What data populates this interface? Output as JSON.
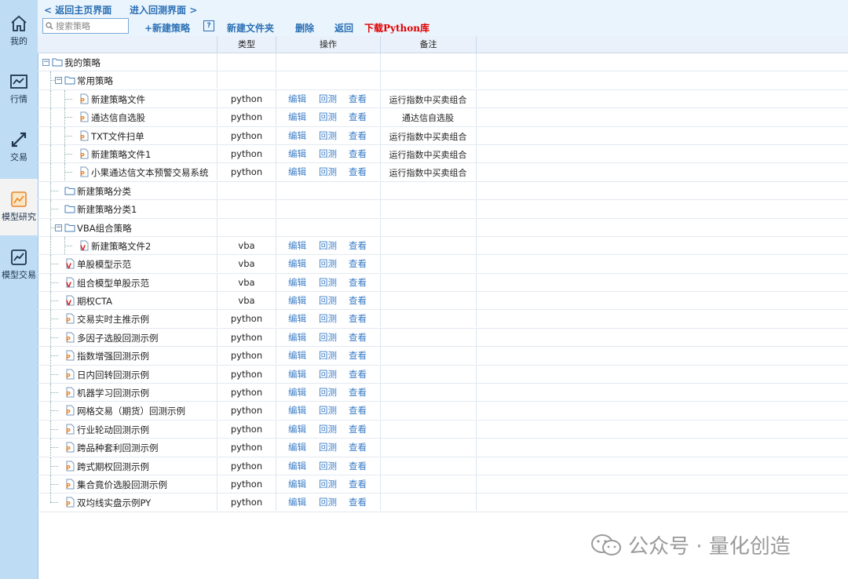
{
  "sidebar": {
    "items": [
      {
        "label": "我的",
        "icon": "home-icon"
      },
      {
        "label": "行情",
        "icon": "chart-line-icon"
      },
      {
        "label": "交易",
        "icon": "exchange-arrows-icon"
      },
      {
        "label": "模型研究",
        "icon": "model-research-icon",
        "active": true
      },
      {
        "label": "模型交易",
        "icon": "model-trade-icon"
      }
    ]
  },
  "breadcrumb": {
    "back_home": "返回主页界面",
    "enter_backtest": "进入回测界面"
  },
  "toolbar": {
    "search_placeholder": "搜索策略",
    "new_strategy": "+新建策略",
    "help": "?",
    "new_folder": "新建文件夹",
    "delete": "删除",
    "back": "返回",
    "download_lib": "下载Python库"
  },
  "table": {
    "headers": {
      "type": "类型",
      "ops": "操作",
      "note": "备注"
    },
    "op_labels": {
      "edit": "编辑",
      "backtest": "回测",
      "view": "查看"
    },
    "rows": [
      {
        "level": 0,
        "kind": "folder",
        "expand": "⊟",
        "name": "我的策略",
        "type": "",
        "ops": false,
        "note": ""
      },
      {
        "level": 1,
        "kind": "folder",
        "expand": "⊟",
        "name": "常用策略",
        "type": "",
        "ops": false,
        "note": ""
      },
      {
        "level": 2,
        "kind": "py",
        "name": "新建策略文件",
        "type": "python",
        "ops": true,
        "note": "运行指数中买卖组合"
      },
      {
        "level": 2,
        "kind": "py",
        "name": "通达信自选股",
        "type": "python",
        "ops": true,
        "note": "通达信自选股"
      },
      {
        "level": 2,
        "kind": "py",
        "name": "TXT文件扫单",
        "type": "python",
        "ops": true,
        "note": "运行指数中买卖组合"
      },
      {
        "level": 2,
        "kind": "py",
        "name": "新建策略文件1",
        "type": "python",
        "ops": true,
        "note": "运行指数中买卖组合"
      },
      {
        "level": 2,
        "kind": "py",
        "name": "小果通达信文本预警交易系统",
        "type": "python",
        "ops": true,
        "note": "运行指数中买卖组合"
      },
      {
        "level": 1,
        "kind": "folder",
        "name": "新建策略分类",
        "type": "",
        "ops": false,
        "note": ""
      },
      {
        "level": 1,
        "kind": "folder",
        "name": "新建策略分类1",
        "type": "",
        "ops": false,
        "note": ""
      },
      {
        "level": 1,
        "kind": "folder",
        "expand": "⊟",
        "name": "VBA组合策略",
        "type": "",
        "ops": false,
        "note": ""
      },
      {
        "level": 2,
        "kind": "vba",
        "name": "新建策略文件2",
        "type": "vba",
        "ops": true,
        "note": ""
      },
      {
        "level": 1,
        "kind": "vba",
        "name": "单股模型示范",
        "type": "vba",
        "ops": true,
        "note": ""
      },
      {
        "level": 1,
        "kind": "vba",
        "name": "组合模型单股示范",
        "type": "vba",
        "ops": true,
        "note": ""
      },
      {
        "level": 1,
        "kind": "vba",
        "name": "期权CTA",
        "type": "vba",
        "ops": true,
        "note": ""
      },
      {
        "level": 1,
        "kind": "py",
        "name": "交易实时主推示例",
        "type": "python",
        "ops": true,
        "note": ""
      },
      {
        "level": 1,
        "kind": "py",
        "name": "多因子选股回测示例",
        "type": "python",
        "ops": true,
        "note": ""
      },
      {
        "level": 1,
        "kind": "py",
        "name": "指数增强回测示例",
        "type": "python",
        "ops": true,
        "note": ""
      },
      {
        "level": 1,
        "kind": "py",
        "name": "日内回转回测示例",
        "type": "python",
        "ops": true,
        "note": ""
      },
      {
        "level": 1,
        "kind": "py",
        "name": "机器学习回测示例",
        "type": "python",
        "ops": true,
        "note": ""
      },
      {
        "level": 1,
        "kind": "py",
        "name": "网格交易（期货）回测示例",
        "type": "python",
        "ops": true,
        "note": ""
      },
      {
        "level": 1,
        "kind": "py",
        "name": "行业轮动回测示例",
        "type": "python",
        "ops": true,
        "note": ""
      },
      {
        "level": 1,
        "kind": "py",
        "name": "跨品种套利回测示例",
        "type": "python",
        "ops": true,
        "note": ""
      },
      {
        "level": 1,
        "kind": "py",
        "name": "跨式期权回测示例",
        "type": "python",
        "ops": true,
        "note": ""
      },
      {
        "level": 1,
        "kind": "py",
        "name": "集合竟价选股回测示例",
        "type": "python",
        "ops": true,
        "note": ""
      },
      {
        "level": 1,
        "kind": "py",
        "name": "双均线实盘示例PY",
        "type": "python",
        "ops": true,
        "note": ""
      }
    ]
  },
  "watermark": "公众号 · 量化创造",
  "colors": {
    "sidebar_bg": "#bfdcf5",
    "link_blue": "#2a6fb4",
    "download_red": "#e00000",
    "py_icon": "#e8862a",
    "vba_icon": "#d62b2b"
  }
}
